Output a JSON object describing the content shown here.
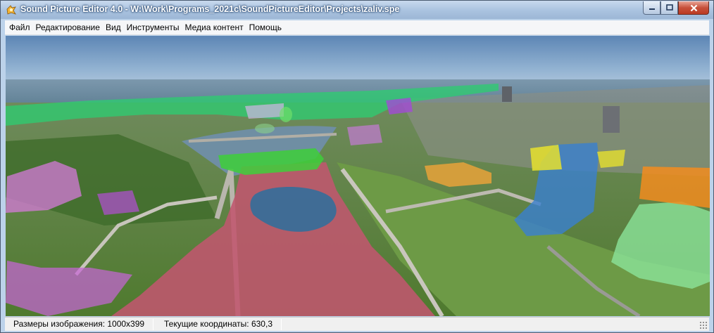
{
  "window": {
    "title": "Sound Picture Editor 4.0 - W:\\Work\\Programs_2021c\\SoundPictureEditor\\Projects\\zaliv.spe",
    "icon": "app-icon",
    "buttons": {
      "minimize": "minimize-icon",
      "maximize": "maximize-icon",
      "close": "close-icon"
    }
  },
  "menu": {
    "items": [
      {
        "label": "Файл"
      },
      {
        "label": "Редактирование"
      },
      {
        "label": "Вид"
      },
      {
        "label": "Инструменты"
      },
      {
        "label": "Медиа контент"
      },
      {
        "label": "Помощь"
      }
    ]
  },
  "canvas": {
    "image": "aerial-city-panorama",
    "regions": [
      {
        "name": "water-bay",
        "color": "#2ecc71"
      },
      {
        "name": "river",
        "color": "#c0566e"
      },
      {
        "name": "fountain",
        "color": "#2c6e9e"
      },
      {
        "name": "bridge",
        "color": "#3ecf3a"
      },
      {
        "name": "building-pink-left",
        "color": "#d67ad9"
      },
      {
        "name": "building-purple",
        "color": "#b54fd6"
      },
      {
        "name": "tower-blue",
        "color": "#3a7fd0"
      },
      {
        "name": "building-green-right",
        "color": "#8be39a"
      },
      {
        "name": "building-orange-right",
        "color": "#f28c1e"
      },
      {
        "name": "building-orange-center",
        "color": "#e8a23a"
      },
      {
        "name": "building-yellow",
        "color": "#e6e02e"
      }
    ]
  },
  "status": {
    "image_size": "Размеры изображения: 1000x399",
    "coordinates": "Текущие координаты: 630,3"
  }
}
